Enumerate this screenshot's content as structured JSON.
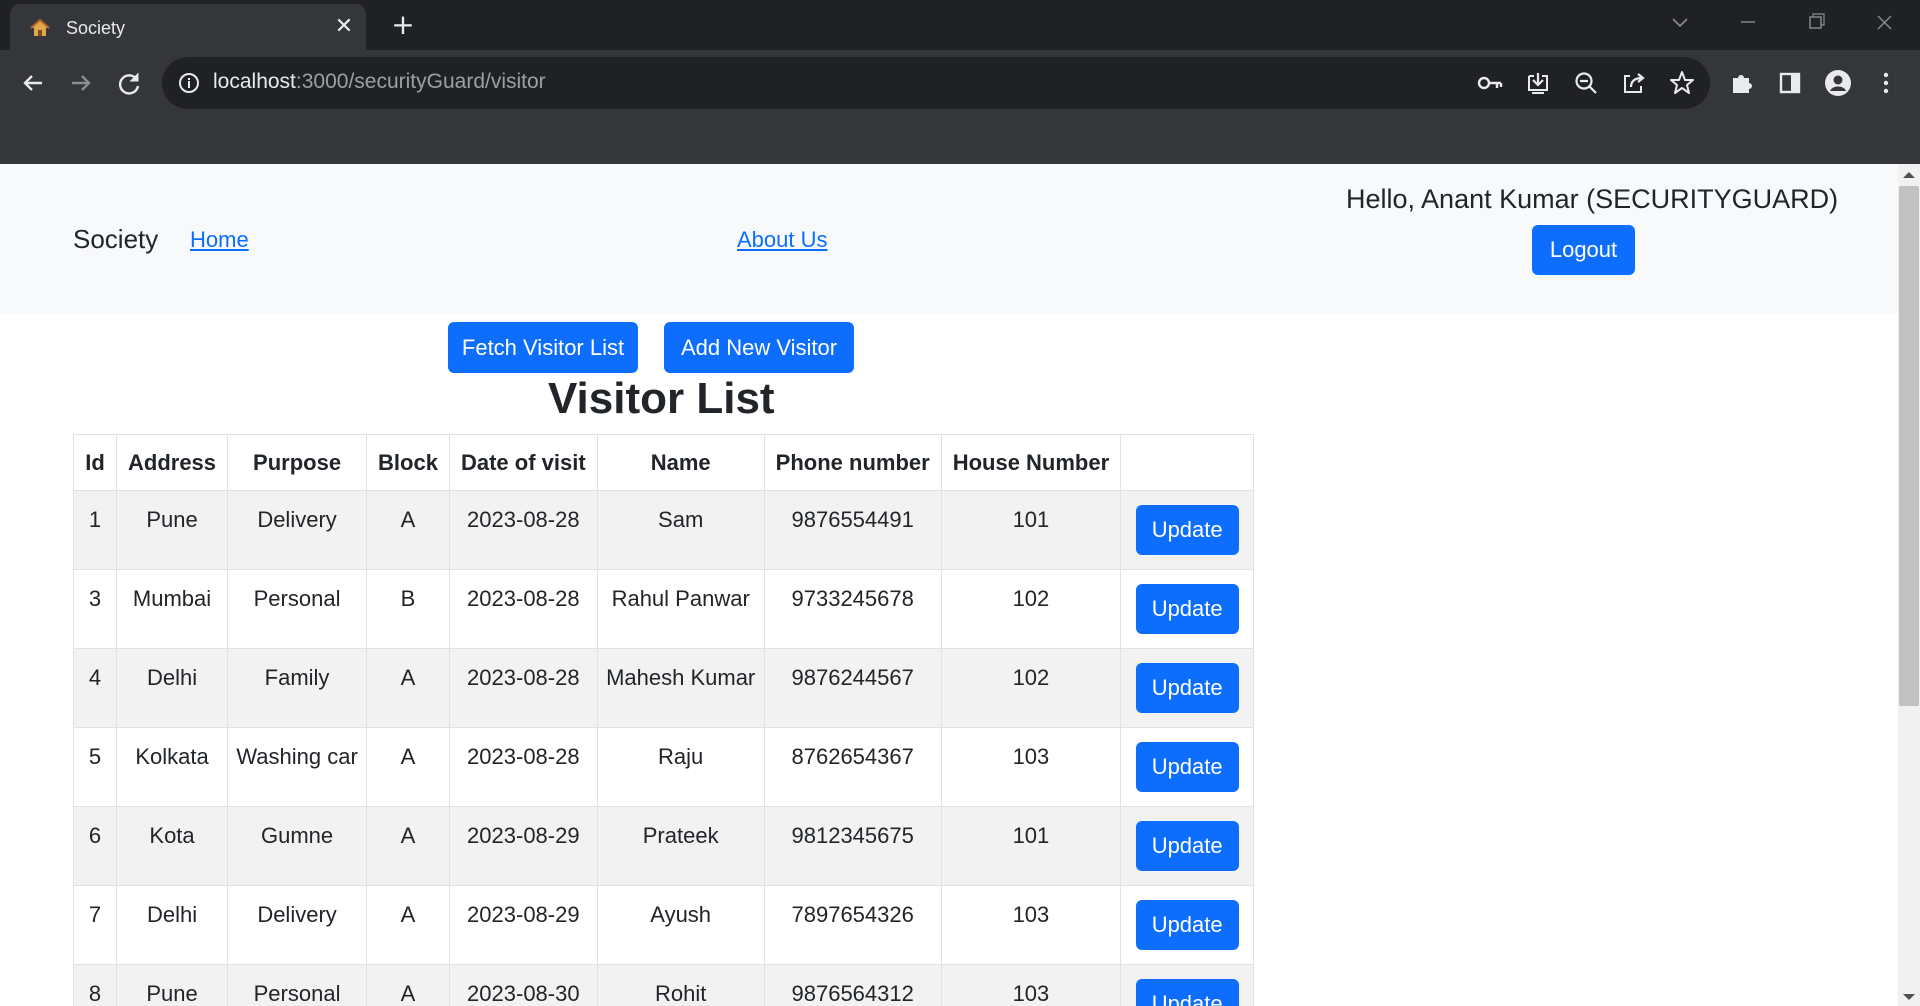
{
  "browser": {
    "tab_title": "Society",
    "url_host": "localhost",
    "url_path": ":3000/securityGuard/visitor"
  },
  "navbar": {
    "brand": "Society",
    "home_link": "Home",
    "about_link": "About Us",
    "greeting": "Hello, Anant Kumar (SECURITYGUARD)",
    "logout_label": "Logout"
  },
  "actions": {
    "fetch_label": "Fetch Visitor List",
    "add_label": "Add New Visitor"
  },
  "heading": "Visitor List",
  "table": {
    "headers": [
      "Id",
      "Address",
      "Purpose",
      "Block",
      "Date of visit",
      "Name",
      "Phone number",
      "House Number",
      ""
    ],
    "update_label": "Update",
    "rows": [
      [
        "1",
        "Pune",
        "Delivery",
        "A",
        "2023-08-28",
        "Sam",
        "9876554491",
        "101"
      ],
      [
        "3",
        "Mumbai",
        "Personal",
        "B",
        "2023-08-28",
        "Rahul Panwar",
        "9733245678",
        "102"
      ],
      [
        "4",
        "Delhi",
        "Family",
        "A",
        "2023-08-28",
        "Mahesh Kumar",
        "9876244567",
        "102"
      ],
      [
        "5",
        "Kolkata",
        "Washing car",
        "A",
        "2023-08-28",
        "Raju",
        "8762654367",
        "103"
      ],
      [
        "6",
        "Kota",
        "Gumne",
        "A",
        "2023-08-29",
        "Prateek",
        "9812345675",
        "101"
      ],
      [
        "7",
        "Delhi",
        "Delivery",
        "A",
        "2023-08-29",
        "Ayush",
        "7897654326",
        "103"
      ],
      [
        "8",
        "Pune",
        "Personal",
        "A",
        "2023-08-30",
        "Rohit",
        "9876564312",
        "103"
      ]
    ]
  },
  "colors": {
    "primary": "#0d6efd",
    "navbar_bg": "#f8f9fa",
    "chrome_dark": "#202124",
    "chrome_toolbar": "#35363a"
  }
}
